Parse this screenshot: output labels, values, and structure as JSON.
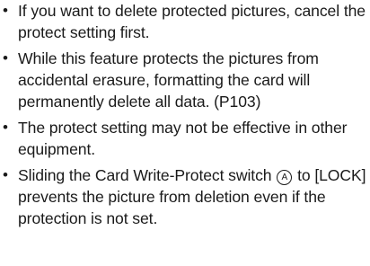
{
  "notes": [
    {
      "bullet": "•",
      "text": "If you want to delete protected pictures, cancel the protect setting first."
    },
    {
      "bullet": "•",
      "text": "While this feature protects the pictures from accidental erasure, formatting the card will permanently delete all data. (P103)"
    },
    {
      "bullet": "•",
      "text": "The protect setting may not be effective in other equipment."
    },
    {
      "bullet": "•",
      "text_before": "Sliding the Card Write-Protect switch",
      "marker": "A",
      "text_after": "to [LOCK] prevents the picture from deletion even if the protection is not set."
    }
  ]
}
